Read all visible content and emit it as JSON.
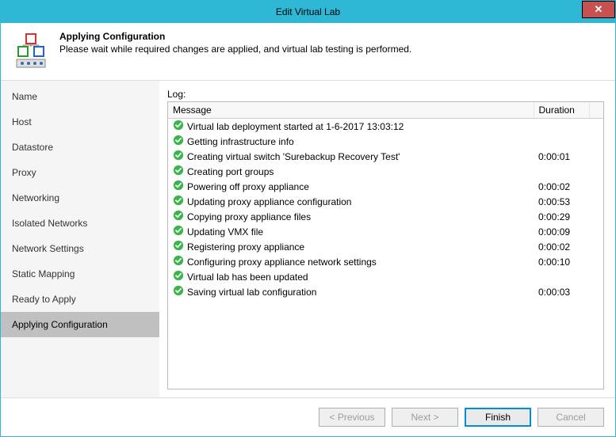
{
  "window": {
    "title": "Edit Virtual Lab",
    "close_glyph": "✕"
  },
  "header": {
    "title": "Applying Configuration",
    "subtitle": "Please wait while required changes are applied, and virtual lab testing is performed."
  },
  "sidebar": {
    "items": [
      {
        "label": "Name",
        "active": false
      },
      {
        "label": "Host",
        "active": false
      },
      {
        "label": "Datastore",
        "active": false
      },
      {
        "label": "Proxy",
        "active": false
      },
      {
        "label": "Networking",
        "active": false
      },
      {
        "label": "Isolated Networks",
        "active": false
      },
      {
        "label": "Network Settings",
        "active": false
      },
      {
        "label": "Static Mapping",
        "active": false
      },
      {
        "label": "Ready to Apply",
        "active": false
      },
      {
        "label": "Applying Configuration",
        "active": true
      }
    ]
  },
  "log": {
    "label": "Log:",
    "columns": {
      "message": "Message",
      "duration": "Duration"
    },
    "rows": [
      {
        "message": "Virtual lab deployment started at 1-6-2017 13:03:12",
        "duration": ""
      },
      {
        "message": "Getting infrastructure info",
        "duration": ""
      },
      {
        "message": "Creating virtual switch 'Surebackup Recovery Test'",
        "duration": "0:00:01"
      },
      {
        "message": "Creating port groups",
        "duration": ""
      },
      {
        "message": "Powering off proxy appliance",
        "duration": "0:00:02"
      },
      {
        "message": "Updating proxy appliance configuration",
        "duration": "0:00:53"
      },
      {
        "message": "Copying proxy appliance files",
        "duration": "0:00:29"
      },
      {
        "message": "Updating VMX file",
        "duration": "0:00:09"
      },
      {
        "message": "Registering proxy appliance",
        "duration": "0:00:02"
      },
      {
        "message": "Configuring proxy appliance network settings",
        "duration": "0:00:10"
      },
      {
        "message": "Virtual lab has been updated",
        "duration": ""
      },
      {
        "message": "Saving virtual lab configuration",
        "duration": "0:00:03"
      }
    ]
  },
  "footer": {
    "previous": "< Previous",
    "next": "Next >",
    "finish": "Finish",
    "cancel": "Cancel"
  }
}
